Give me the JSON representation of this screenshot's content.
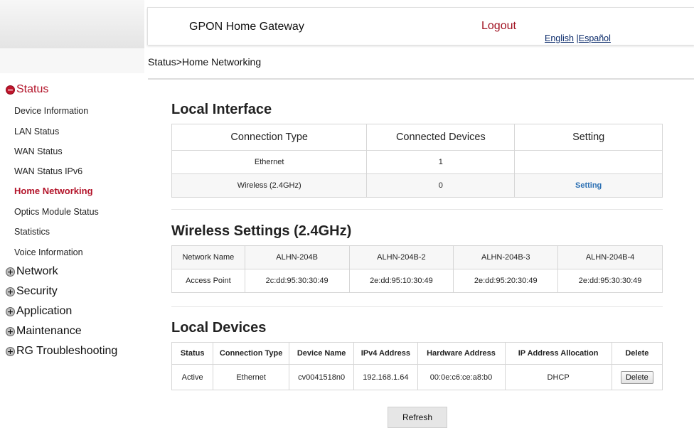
{
  "header": {
    "title": "GPON Home Gateway",
    "logout": "Logout",
    "lang_english": "English",
    "lang_sep": " |",
    "lang_spanish": "Español"
  },
  "breadcrumb": "Status>Home Networking",
  "sidebar": {
    "status": "Status",
    "status_items": [
      "Device Information",
      "LAN Status",
      "WAN Status",
      "WAN Status IPv6",
      "Home Networking",
      "Optics Module Status",
      "Statistics",
      "Voice Information"
    ],
    "sections": [
      "Network",
      "Security",
      "Application",
      "Maintenance",
      "RG Troubleshooting"
    ]
  },
  "local_interface": {
    "title": "Local Interface",
    "headers": [
      "Connection Type",
      "Connected Devices",
      "Setting"
    ],
    "rows": [
      {
        "type": "Ethernet",
        "devices": "1",
        "setting": ""
      },
      {
        "type": "Wireless (2.4GHz)",
        "devices": "0",
        "setting": "Setting"
      }
    ]
  },
  "wireless": {
    "title": "Wireless Settings (2.4GHz)",
    "rows": [
      [
        "Network Name",
        "ALHN-204B",
        "ALHN-204B-2",
        "ALHN-204B-3",
        "ALHN-204B-4"
      ],
      [
        "Access Point",
        "2c:dd:95:30:30:49",
        "2e:dd:95:10:30:49",
        "2e:dd:95:20:30:49",
        "2e:dd:95:30:30:49"
      ]
    ]
  },
  "local_devices": {
    "title": "Local Devices",
    "headers": [
      "Status",
      "Connection Type",
      "Device Name",
      "IPv4 Address",
      "Hardware Address",
      "IP Address Allocation",
      "Delete"
    ],
    "rows": [
      {
        "status": "Active",
        "type": "Ethernet",
        "name": "cv0041518n0",
        "ipv4": "192.168.1.64",
        "mac": "00:0e:c6:ce:a8:b0",
        "alloc": "DHCP",
        "delete": "Delete"
      }
    ]
  },
  "refresh_label": "Refresh",
  "colors": {
    "accent": "#b3142a",
    "link": "#2a6fb3"
  },
  "icons": {
    "status_bullet": "minus-circle-icon",
    "section_bullet": "plus-circle-icon"
  }
}
